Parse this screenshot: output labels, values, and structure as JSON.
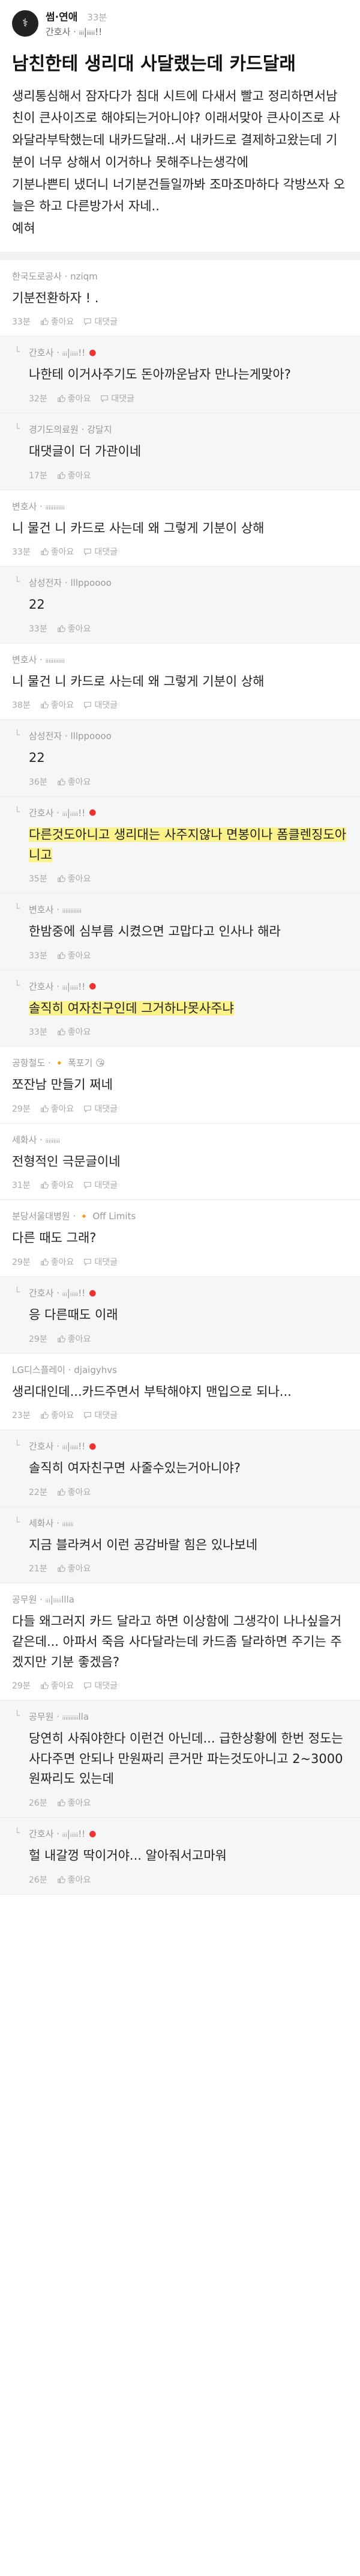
{
  "post": {
    "avatar_glyph": "⚕",
    "board": "썸·연애",
    "time": "33분",
    "author": "간호사 · ᵢᵢᵢ|ᵢᵢᵢᵢᵢ!!",
    "title": "남친한테 생리대 사달랬는데 카드달래",
    "body_lines": [
      "생리통심해서 잠자다가 침대 시트에 다새서 빨고 정리하면서남친이 큰사이즈로 해야되는거아니야? 이래서맞아 큰사이즈로 사와달라부탁했는데 내카드달래..서 내카드로 결제하고왔는데 기분이 너무 상해서 이거하나 못해주나는생각에",
      "기분나쁜티 냈더니 너기분건들일까봐 조마조마하다 각방쓰자 오늘은 하고 다른방가서 자네..",
      "예혀"
    ]
  },
  "comments": [
    {
      "author": "한국도로공사 · nziqm",
      "text": "기분전환하자 ! .",
      "time": "33분",
      "like": "좋아요",
      "reply": "대댓글",
      "reply_style": false,
      "dot": false,
      "highlight": false
    },
    {
      "author": "간호사 · ᵢᵢᵢ|ᵢᵢᵢᵢᵢ!!",
      "text": "나한테 이거사주기도 돈아까운남자 만나는게맞아?",
      "time": "32분",
      "like": "좋아요",
      "reply": "대댓글",
      "reply_style": true,
      "dot": true,
      "highlight": false
    },
    {
      "author": "경기도의료원 · 강달지",
      "text": "대댓글이 더 가관이네",
      "time": "17분",
      "like": "좋아요",
      "reply": "",
      "reply_style": true,
      "dot": false,
      "highlight": false
    },
    {
      "author": "변호사 · ᵢᵢᵢᵢᵢᵢᵢᵢᵢᵢᵢᵢ",
      "text": "니 물건 니 카드로 사는데 왜 그렇게 기분이 상해",
      "time": "33분",
      "like": "좋아요",
      "reply": "대댓글",
      "reply_style": false,
      "dot": false,
      "highlight": false
    },
    {
      "author": "삼성전자 · lllppoooo",
      "text": "22",
      "time": "33분",
      "like": "좋아요",
      "reply": "",
      "reply_style": true,
      "dot": false,
      "highlight": false
    },
    {
      "author": "변호사 · ᵢᵢᵢᵢᵢᵢᵢᵢᵢᵢᵢᵢ",
      "text": "니 물건 니 카드로 사는데 왜 그렇게 기분이 상해",
      "time": "38분",
      "like": "좋아요",
      "reply": "대댓글",
      "reply_style": false,
      "dot": false,
      "highlight": false
    },
    {
      "author": "삼성전자 · lllppoooo",
      "text": "22",
      "time": "36분",
      "like": "좋아요",
      "reply": "",
      "reply_style": true,
      "dot": false,
      "highlight": false
    },
    {
      "author": "간호사 · ᵢᵢᵢ|ᵢᵢᵢᵢᵢ!!",
      "text": "다른것도아니고 생리대는 사주지않나 면봉이나 폼클렌징도아니고",
      "time": "35분",
      "like": "좋아요",
      "reply": "",
      "reply_style": true,
      "dot": true,
      "highlight": true
    },
    {
      "author": "변호사 · ᵢᵢᵢᵢᵢᵢᵢᵢᵢᵢᵢᵢ",
      "text": "한밤중에 심부름 시켰으면 고맙다고 인사나 해라",
      "time": "33분",
      "like": "좋아요",
      "reply": "",
      "reply_style": true,
      "dot": false,
      "highlight": false
    },
    {
      "author": "간호사 · ᵢᵢᵢ|ᵢᵢᵢᵢᵢ!!",
      "text": "솔직히 여자친구인데 그거하나못사주냐",
      "time": "33분",
      "like": "좋아요",
      "reply": "",
      "reply_style": true,
      "dot": true,
      "highlight": true
    },
    {
      "author": "공항철도 · 🔸 폭포기 😘",
      "text": "쪼잔남 만들기 쩌네",
      "time": "29분",
      "like": "좋아요",
      "reply": "대댓글",
      "reply_style": false,
      "dot": false,
      "highlight": false
    },
    {
      "author": "세화사 · ᵢᵢᵢᵢᵢᵢᵢᵢᵢ",
      "text": "전형적인 극문글이네",
      "time": "31분",
      "like": "좋아요",
      "reply": "대댓글",
      "reply_style": false,
      "dot": false,
      "highlight": false
    },
    {
      "author": "분당서울대병원 · 🔸 Off Limits",
      "text": "다른 때도 그래?",
      "time": "29분",
      "like": "좋아요",
      "reply": "대댓글",
      "reply_style": false,
      "dot": false,
      "highlight": false
    },
    {
      "author": "간호사 · ᵢᵢᵢ|ᵢᵢᵢᵢᵢ!!",
      "text": "응 다른때도 이래",
      "time": "29분",
      "like": "좋아요",
      "reply": "",
      "reply_style": true,
      "dot": true,
      "highlight": false
    },
    {
      "author": "LG디스플레이 · djaigyhvs",
      "text": "생리대인데...카드주면서 부탁해야지 맨입으로 되나...",
      "time": "23분",
      "like": "좋아요",
      "reply": "대댓글",
      "reply_style": false,
      "dot": false,
      "highlight": false
    },
    {
      "author": "간호사 · ᵢᵢᵢ|ᵢᵢᵢᵢᵢ!!",
      "text": "솔직히 여자친구면 사줄수있는거아니야?",
      "time": "22분",
      "like": "좋아요",
      "reply": "",
      "reply_style": true,
      "dot": true,
      "highlight": false
    },
    {
      "author": "세화사 · ᵢᵢᵢᵢᵢᵢᵢ",
      "text": "지금 블라켜서 이런 공감바랄 힘은 있나보네",
      "time": "21분",
      "like": "좋아요",
      "reply": "",
      "reply_style": true,
      "dot": false,
      "highlight": false
    },
    {
      "author": "공무원 · ᵢᵢᵢ|ᵢᵢᵢᵢᵢllla",
      "text": "다들 왜그러지 카드 달라고 하면 이상함에 그생각이 나나싶을거 같은데... 아파서 죽음 사다달라는데 카드좀 달라하면 주기는 주겠지만 기분 좋겠음?",
      "time": "29분",
      "like": "좋아요",
      "reply": "대댓글",
      "reply_style": false,
      "dot": false,
      "highlight": false
    },
    {
      "author": "공무원 · ᵢᵢᵢᵢᵢᵢᵢᵢᵢᵢlla",
      "text": "당연히 사줘야한다 이런건 아닌데... 급한상황에 한번 정도는 사다주면 안되나 만원짜리 큰거만 파는것도아니고 2~3000원짜리도 있는데",
      "time": "26분",
      "like": "좋아요",
      "reply": "",
      "reply_style": true,
      "dot": false,
      "highlight": false
    },
    {
      "author": "간호사 · ᵢᵢᵢ|ᵢᵢᵢᵢᵢ!!",
      "text": "헐 내갈껑 딱이거야... 알아줘서고마워",
      "time": "26분",
      "like": "좋아요",
      "reply": "",
      "reply_style": true,
      "dot": true,
      "highlight": false
    }
  ]
}
